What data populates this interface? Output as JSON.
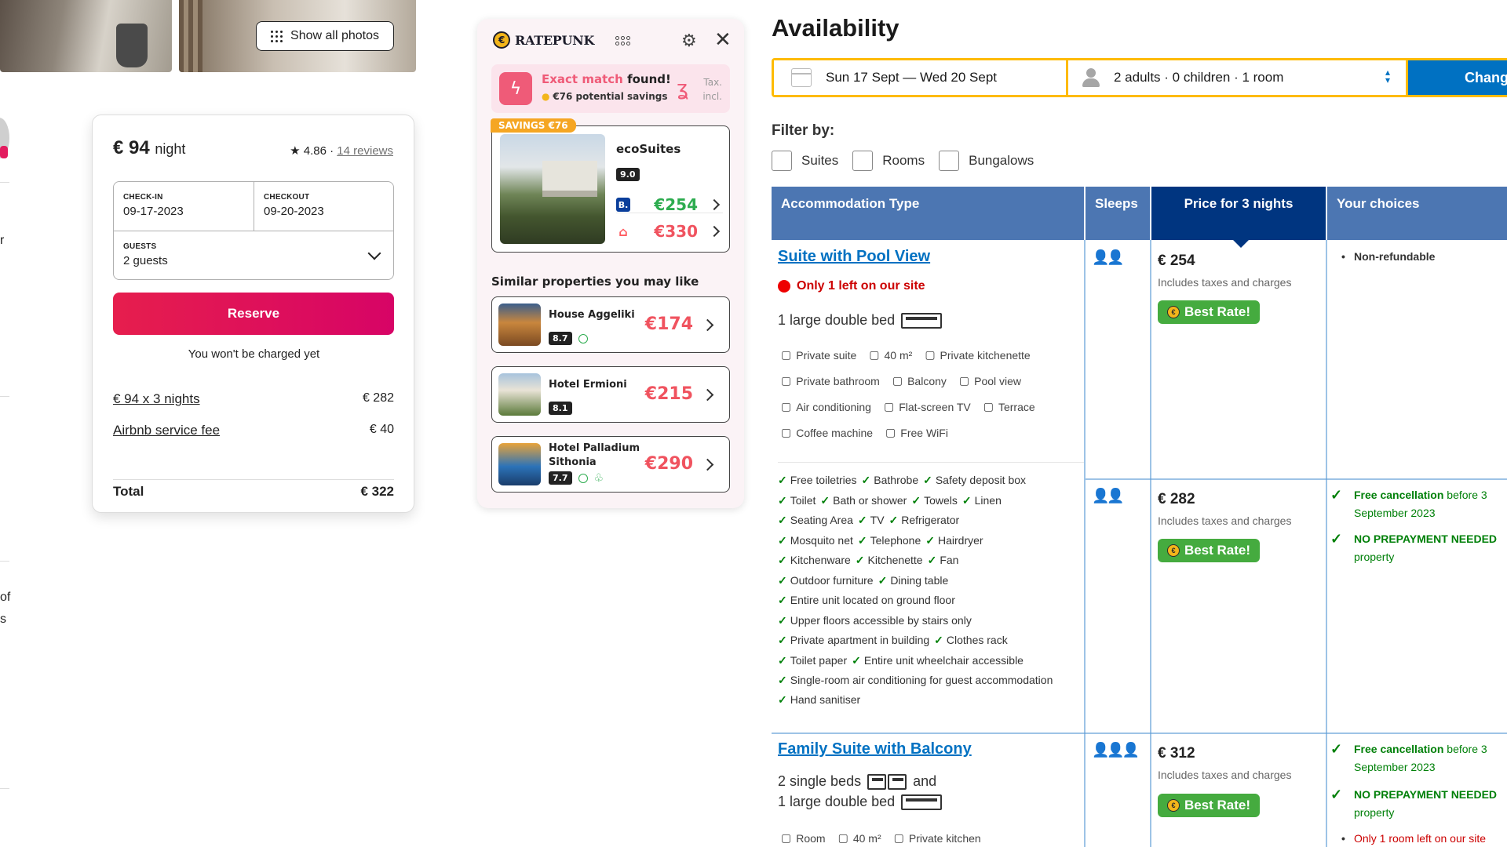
{
  "airbnb": {
    "show_photos": "Show all photos",
    "edge_texts": [
      "r",
      "of",
      "s"
    ],
    "price": "€ 94",
    "price_unit": "night",
    "rating": "4.86",
    "reviews": "14 reviews",
    "checkin_label": "CHECK-IN",
    "checkin_value": "09-17-2023",
    "checkout_label": "CHECKOUT",
    "checkout_value": "09-20-2023",
    "guests_label": "GUESTS",
    "guests_value": "2 guests",
    "reserve": "Reserve",
    "not_charged": "You won't be charged yet",
    "nights_label": "€ 94 x 3 nights",
    "nights_amount": "€ 282",
    "fee_label": "Airbnb service fee",
    "fee_amount": "€ 40",
    "total_label": "Total",
    "total_amount": "€ 322"
  },
  "ratepunk": {
    "logo": "RATEPUNK",
    "match_highlight": "Exact match",
    "match_rest": "found!",
    "savings_text": "€76 potential savings",
    "tax_line1": "Tax.",
    "tax_line2": "incl.",
    "savings_badge": "SAVINGS €76",
    "deal_name": "ecoSuites",
    "deal_score": "9.0",
    "deal_prices": [
      {
        "source": "B.",
        "price": "€254",
        "color": "#2dac4f"
      },
      {
        "source": "airbnb-icon",
        "price": "€330",
        "color": "#f0535f"
      }
    ],
    "similar_title": "Similar properties you may like",
    "similar": [
      {
        "name": "House Aggeliki",
        "score": "8.7",
        "price": "€174"
      },
      {
        "name": "Hotel Ermioni",
        "score": "8.1",
        "price": "€215"
      },
      {
        "name": "Hotel Palladium Sithonia",
        "score": "7.7",
        "price": "€290"
      }
    ]
  },
  "booking": {
    "title": "Availability",
    "dates": "Sun 17 Sept — Wed 20 Sept",
    "guests": "2 adults · 0 children · 1 room",
    "change": "Chang",
    "filter_label": "Filter by:",
    "filters": [
      "Suites",
      "Rooms",
      "Bungalows"
    ],
    "headers": {
      "acc": "Accommodation Type",
      "sleeps": "Sleeps",
      "price": "Price for 3 nights",
      "choices": "Your choices"
    },
    "room1": {
      "name": "Suite with Pool View",
      "only_left": "Only 1 left on our site",
      "beds": "1 large double bed",
      "facilities": [
        [
          "Private suite",
          "40 m²",
          "Private kitchenette"
        ],
        [
          "Private bathroom",
          "Balcony",
          "Pool view"
        ],
        [
          "Air conditioning",
          "Flat-screen TV",
          "Terrace"
        ],
        [
          "Coffee machine",
          "Free WiFi"
        ]
      ],
      "amenities": [
        [
          "Free toiletries",
          "Bathrobe",
          "Safety deposit box"
        ],
        [
          "Toilet",
          "Bath or shower",
          "Towels",
          "Linen"
        ],
        [
          "Seating Area",
          "TV",
          "Refrigerator"
        ],
        [
          "Mosquito net",
          "Telephone",
          "Hairdryer"
        ],
        [
          "Kitchenware",
          "Kitchenette",
          "Fan"
        ],
        [
          "Outdoor furniture",
          "Dining table"
        ],
        [
          "Entire unit located on ground floor"
        ],
        [
          "Upper floors accessible by stairs only"
        ],
        [
          "Private apartment in building",
          "Clothes rack"
        ],
        [
          "Toilet paper",
          "Entire unit wheelchair accessible"
        ],
        [
          "Single-room air conditioning for guest accommodation"
        ],
        [
          "Hand sanitiser"
        ]
      ]
    },
    "options": [
      {
        "price": "€ 254",
        "includes": "Includes taxes and charges",
        "best": "Best Rate!",
        "choice": "Non-refundable"
      },
      {
        "price": "€ 282",
        "includes": "Includes taxes and charges",
        "best": "Best Rate!",
        "cancel_bold": "Free cancellation",
        "cancel_rest": "before 3 September 2023",
        "prepay_bold": "NO PREPAYMENT NEEDED",
        "prepay_rest": "property"
      }
    ],
    "room2": {
      "name": "Family Suite with Balcony",
      "beds_line1": "2 single beds",
      "beds_and": "and",
      "beds_line2": "1 large double bed",
      "facilities": [
        "Room",
        "40 m²",
        "Private kitchen"
      ],
      "price": "€ 312",
      "includes": "Includes taxes and charges",
      "best": "Best Rate!",
      "cancel_bold": "Free cancellation",
      "cancel_rest": "before 3 September 2023",
      "prepay_bold": "NO PREPAYMENT NEEDED",
      "prepay_rest": "property",
      "only_left": "Only 1 room left on our site"
    }
  }
}
